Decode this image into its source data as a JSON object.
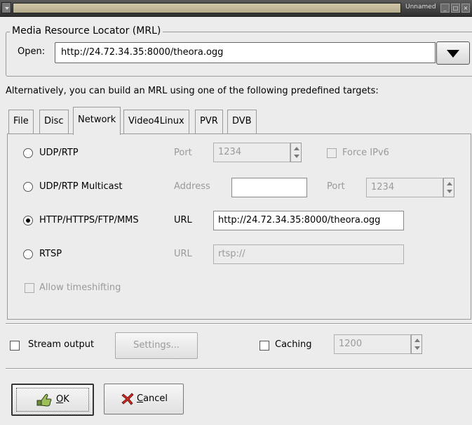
{
  "titlebar": {
    "title": "Unnamed"
  },
  "mrl": {
    "frame_label": "Media Resource Locator (MRL)",
    "open_label": "Open:",
    "open_value": "http://24.72.34.35:8000/theora.ogg"
  },
  "alt_text": "Alternatively, you can build an MRL using one of the following predefined targets:",
  "tabs": [
    {
      "label": "File",
      "active": false
    },
    {
      "label": "Disc",
      "active": false
    },
    {
      "label": "Network",
      "active": true
    },
    {
      "label": "Video4Linux",
      "active": false
    },
    {
      "label": "PVR",
      "active": false
    },
    {
      "label": "DVB",
      "active": false
    }
  ],
  "network": {
    "udp": {
      "label": "UDP/RTP",
      "selected": false,
      "port_label": "Port",
      "port_value": "1234",
      "force_ipv6_label": "Force IPv6",
      "force_ipv6_checked": false
    },
    "multicast": {
      "label": "UDP/RTP Multicast",
      "selected": false,
      "address_label": "Address",
      "address_value": "",
      "port_label": "Port",
      "port_value": "1234"
    },
    "http": {
      "label": "HTTP/HTTPS/FTP/MMS",
      "selected": true,
      "url_label": "URL",
      "url_value": "http://24.72.34.35:8000/theora.ogg"
    },
    "rtsp": {
      "label": "RTSP",
      "selected": false,
      "url_label": "URL",
      "url_value": "rtsp://"
    },
    "timeshift": {
      "label": "Allow timeshifting",
      "checked": false
    }
  },
  "stream_output": {
    "label": "Stream output",
    "checked": false,
    "settings_label": "Settings..."
  },
  "caching": {
    "label": "Caching",
    "checked": false,
    "value": "1200"
  },
  "buttons": {
    "ok_mnemonic": "O",
    "ok_rest": "K",
    "cancel_mnemonic": "C",
    "cancel_rest": "ancel"
  },
  "icons": {
    "ok": "hand-pointing-check-icon",
    "cancel": "red-x-icon"
  }
}
